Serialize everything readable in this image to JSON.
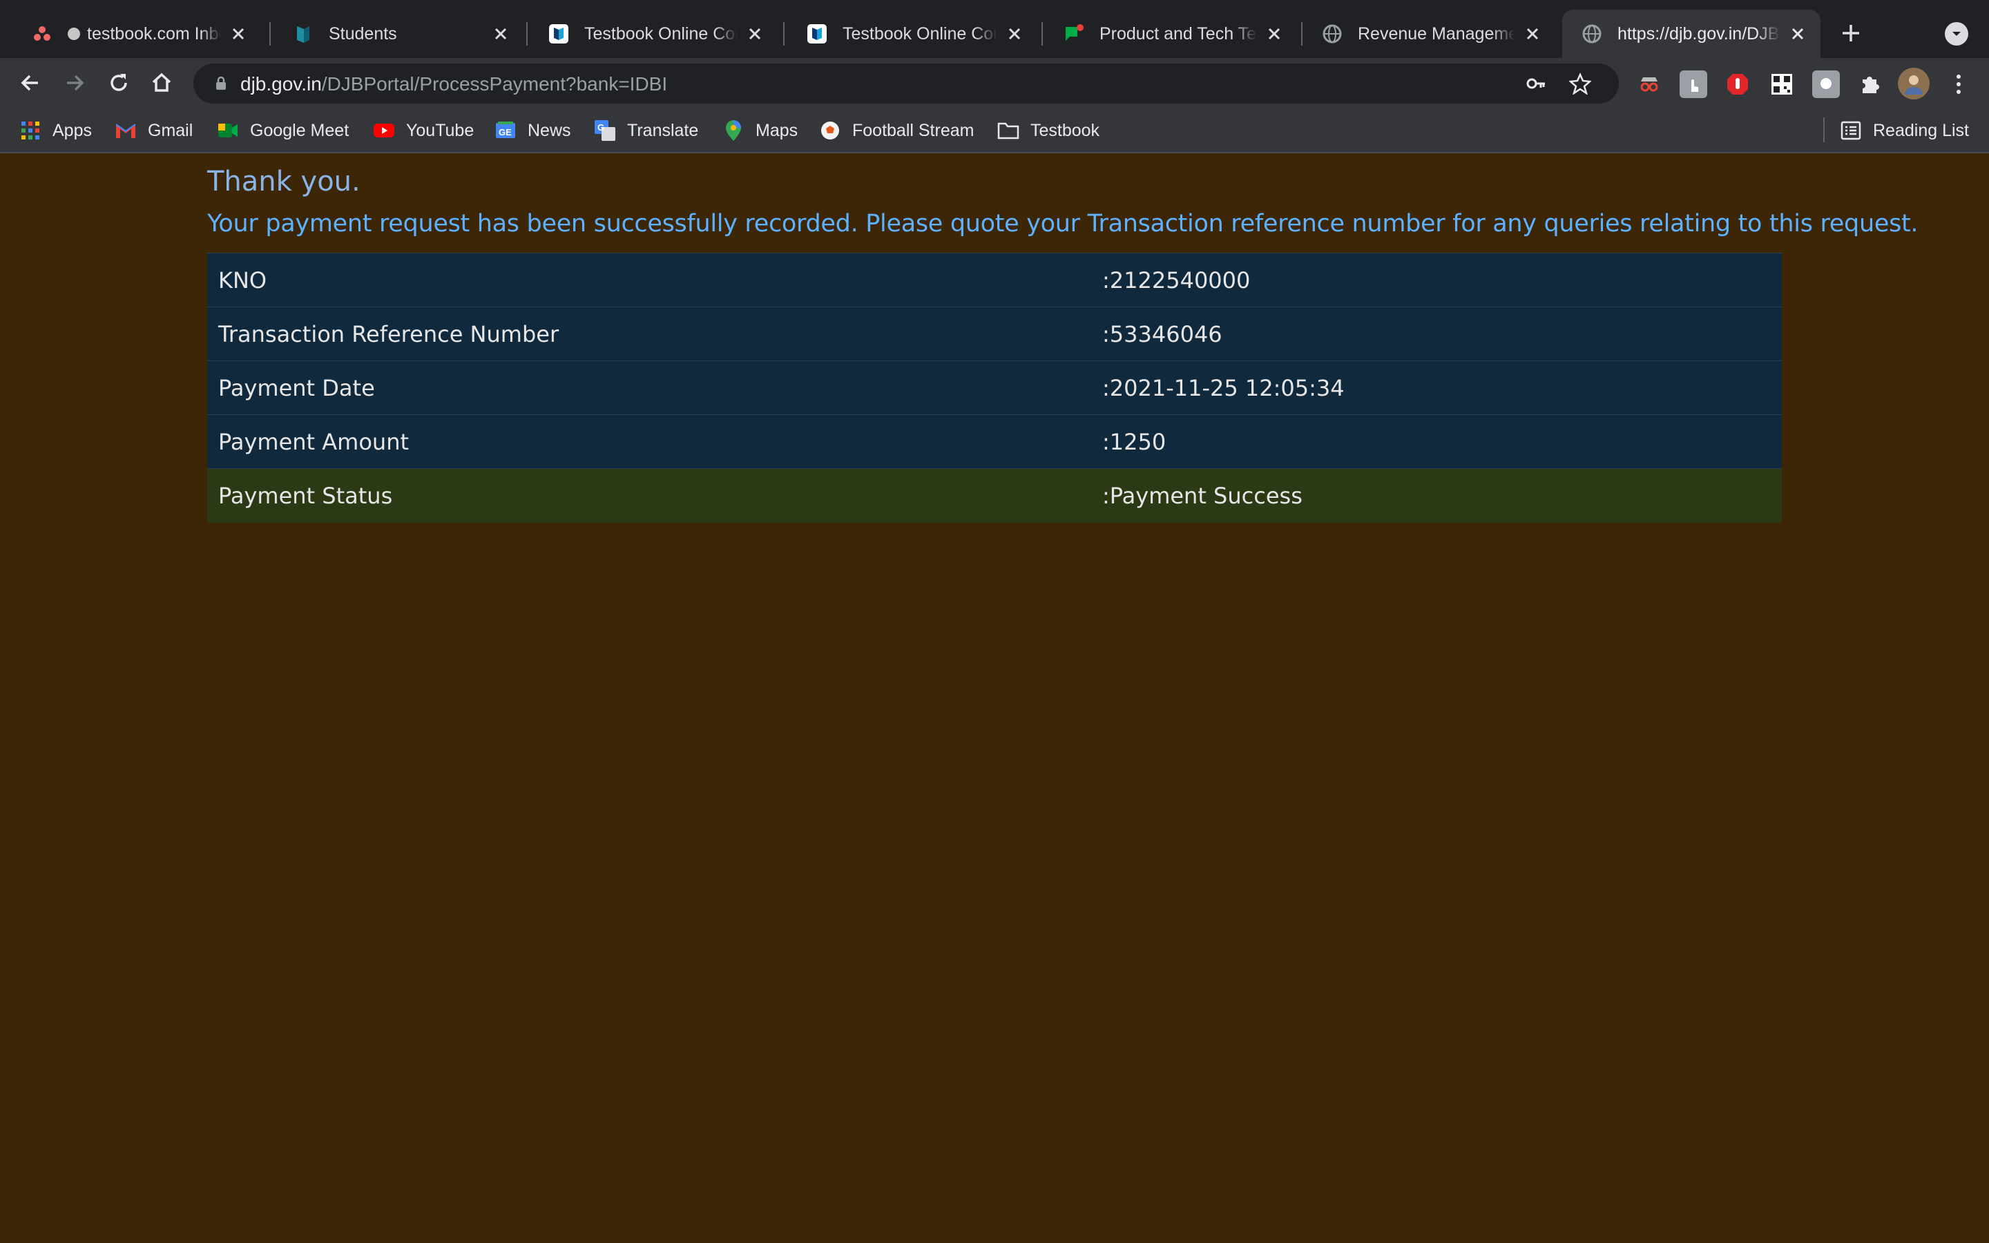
{
  "browser": {
    "tabs": [
      {
        "title": "testbook.com Inbox",
        "favicon": "asana-icon"
      },
      {
        "title": "Students",
        "favicon": "students-logo-icon"
      },
      {
        "title": "Testbook Online Courses",
        "favicon": "testbook-icon"
      },
      {
        "title": "Testbook Online Courses",
        "favicon": "testbook-icon"
      },
      {
        "title": "Product and Tech Team",
        "favicon": "chat-icon"
      },
      {
        "title": "Revenue Management",
        "favicon": "globe-icon"
      },
      {
        "title": "https://djb.gov.in/DJBPortal",
        "favicon": "globe-icon",
        "active": true
      }
    ],
    "address_bar": {
      "host": "djb.gov.in",
      "path": "/DJBPortal/ProcessPayment?bank=IDBI"
    },
    "bookmarks": [
      {
        "label": "Apps",
        "icon": "apps-grid-icon"
      },
      {
        "label": "Gmail",
        "icon": "gmail-icon"
      },
      {
        "label": "Google Meet",
        "icon": "meet-icon"
      },
      {
        "label": "YouTube",
        "icon": "youtube-icon"
      },
      {
        "label": "News",
        "icon": "news-icon"
      },
      {
        "label": "Translate",
        "icon": "translate-icon"
      },
      {
        "label": "Maps",
        "icon": "maps-icon"
      },
      {
        "label": "Football Stream",
        "icon": "football-icon"
      },
      {
        "label": "Testbook",
        "icon": "folder-icon"
      }
    ],
    "reading_list": "Reading List"
  },
  "page": {
    "thanks": "Thank you.",
    "message": "Your payment request has been successfully recorded. Please quote your Transaction reference number for any queries relating to this request.",
    "rows": [
      {
        "label": "KNO",
        "value": ":2122540000"
      },
      {
        "label": "Transaction Reference Number",
        "value": ":53346046"
      },
      {
        "label": "Payment Date",
        "value": ":2021-11-25 12:05:34"
      },
      {
        "label": "Payment Amount",
        "value": ":1250"
      },
      {
        "label": "Payment Status",
        "value": ":Payment Success"
      }
    ]
  },
  "colors": {
    "page_background": "#3c2605",
    "row_background": "#10293c",
    "success_row_background": "#2b3a14",
    "message_text": "#5db1ff"
  }
}
